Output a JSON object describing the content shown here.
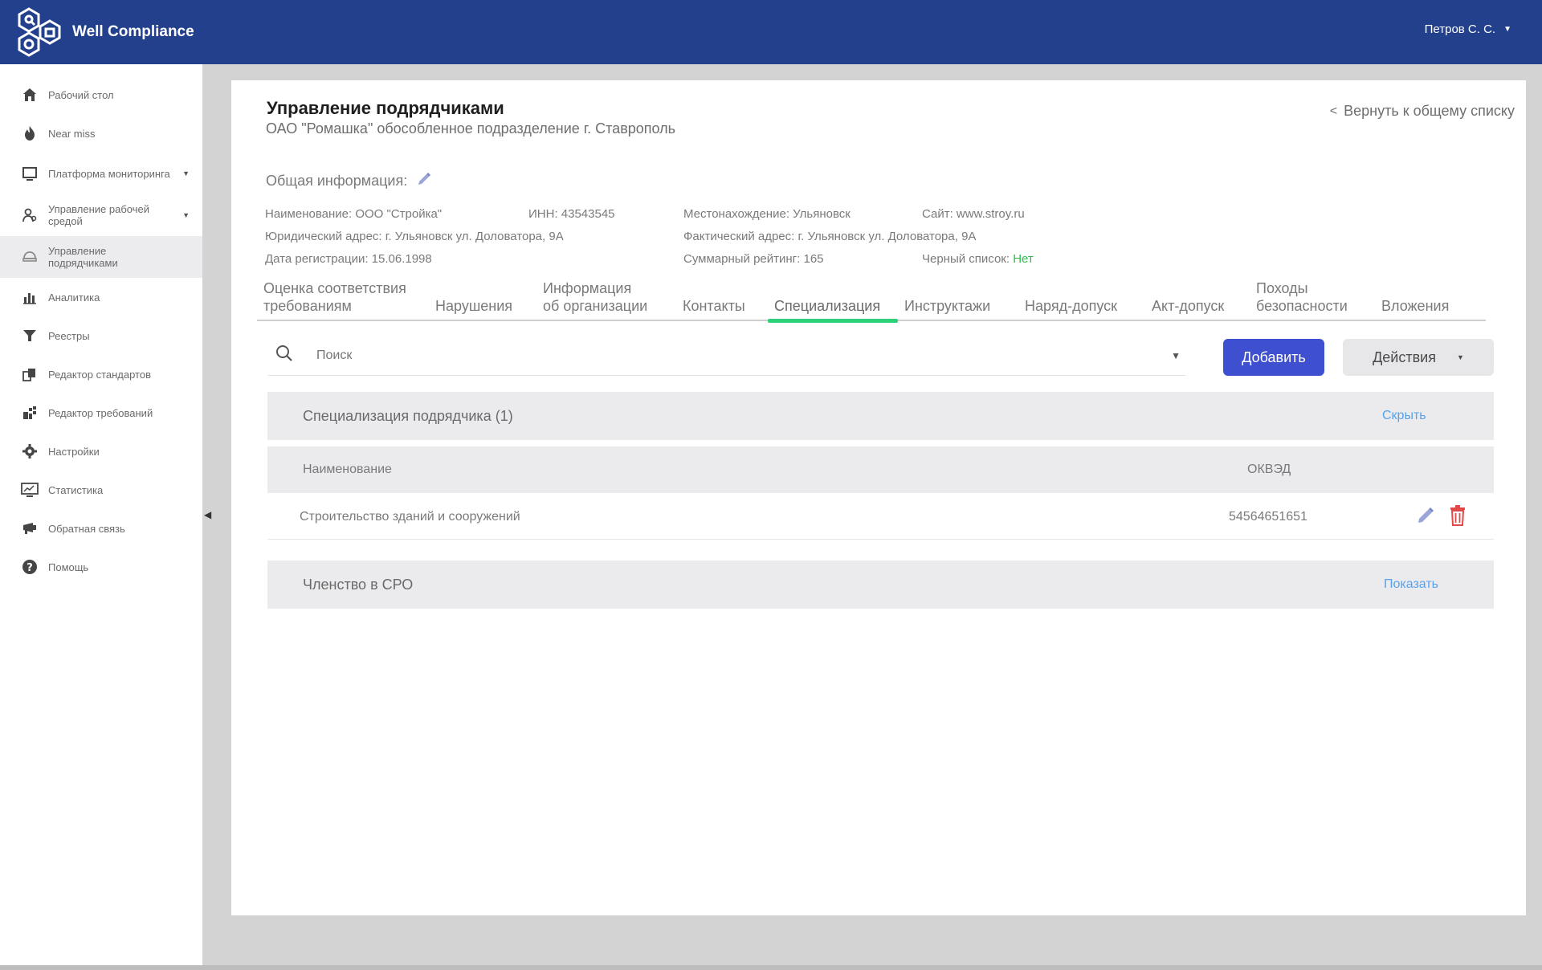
{
  "app": {
    "name": "Well Compliance"
  },
  "user": {
    "name": "Петров С. С."
  },
  "colors": {
    "topbar": "#23408c",
    "primary": "#3e4fcf",
    "accent_tab": "#2fd07a",
    "link": "#5aa2ea",
    "danger": "#e24a4a",
    "status_ok": "#2fbd4d"
  },
  "sidebar": {
    "items": [
      {
        "label": "Рабочий стол",
        "icon": "home-icon"
      },
      {
        "label": "Near miss",
        "icon": "fire-icon"
      },
      {
        "label": "Платформа мониторинга",
        "icon": "monitor-platform-icon",
        "has_submenu": true
      },
      {
        "label": "Управление рабочей средой",
        "icon": "workplace-icon",
        "has_submenu": true
      },
      {
        "label": "Управление подрядчиками",
        "icon": "contractors-icon",
        "active": true
      },
      {
        "label": "Аналитика",
        "icon": "bar-chart-icon"
      },
      {
        "label": "Реестры",
        "icon": "funnel-icon"
      },
      {
        "label": "Редактор стандартов",
        "icon": "documents-icon"
      },
      {
        "label": "Редактор требований",
        "icon": "requirements-icon"
      },
      {
        "label": "Настройки",
        "icon": "gear-icon"
      },
      {
        "label": "Статистика",
        "icon": "statistics-icon"
      },
      {
        "label": "Обратная связь",
        "icon": "feedback-icon"
      },
      {
        "label": "Помощь",
        "icon": "help-icon"
      }
    ]
  },
  "page": {
    "title": "Управление подрядчиками",
    "subtitle": "ОАО \"Ромашка\" обособленное подразделение г. Ставрополь",
    "back_label": "Вернуть к общему списку"
  },
  "info": {
    "header": "Общая информация:",
    "name": "Наименование: ООО \"Стройка\"",
    "inn": "ИНН: 43543545",
    "location": "Местонахождение: Ульяновск",
    "site": "Сайт: www.stroy.ru",
    "legal_address": "Юридический адрес: г. Ульяновск ул. Доловатора, 9А",
    "actual_address": "Фактический адрес: г. Ульяновск ул. Доловатора, 9А",
    "reg_date": "Дата регистрации: 15.06.1998",
    "rating": "Суммарный рейтинг: 165",
    "blacklist_label": "Черный список:",
    "blacklist_value": "Нет"
  },
  "tabs": [
    {
      "line1": "Оценка соответствия",
      "line2": "требованиям"
    },
    {
      "line1": "Нарушения",
      "line2": ""
    },
    {
      "line1": "Информация",
      "line2": "об организации"
    },
    {
      "line1": "Контакты",
      "line2": ""
    },
    {
      "line1": "Специализация",
      "line2": "",
      "active": true
    },
    {
      "line1": "Инструктажи",
      "line2": ""
    },
    {
      "line1": "Наряд-допуск",
      "line2": ""
    },
    {
      "line1": "Акт-допуск",
      "line2": ""
    },
    {
      "line1": "Походы",
      "line2": "безопасности"
    },
    {
      "line1": "Вложения",
      "line2": ""
    }
  ],
  "toolbar": {
    "search_placeholder": "Поиск",
    "add_label": "Добавить",
    "actions_label": "Действия"
  },
  "specialization": {
    "title": "Специализация подрядчика (1)",
    "toggle_label": "Скрыть",
    "columns": {
      "name": "Наименование",
      "okved": "ОКВЭД"
    },
    "rows": [
      {
        "name": "Строительство зданий и сооружений",
        "okved": "54564651651"
      }
    ]
  },
  "sro": {
    "title": "Членство в СРО",
    "toggle_label": "Показать"
  }
}
